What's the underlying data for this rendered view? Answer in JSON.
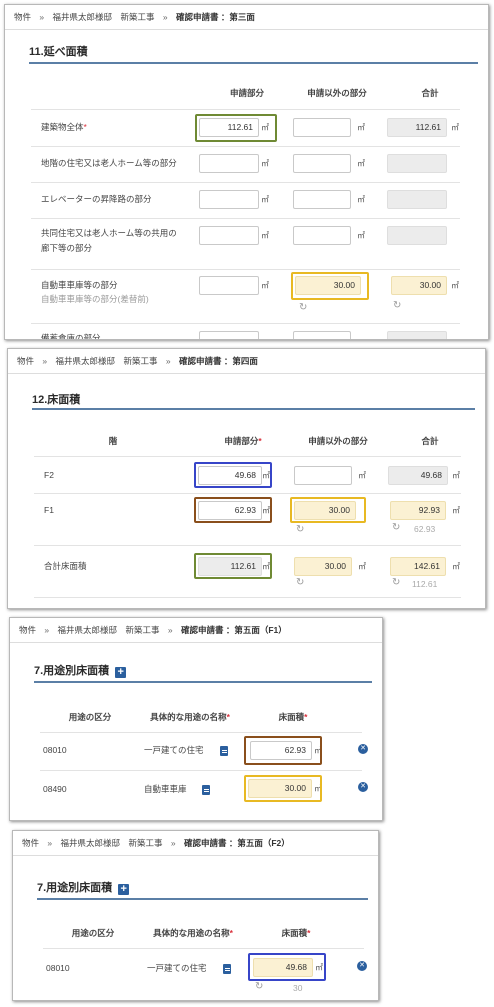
{
  "panel1": {
    "breadcrumb": {
      "item1": "物件",
      "sep": "»",
      "item2": "福井県太郎様邸　新築工事",
      "current": "確認申請書 ：第三面"
    },
    "title": "11.延べ面積",
    "headers": {
      "applied": "申請部分",
      "other": "申請以外の部分",
      "total": "合計"
    },
    "unit": "㎡",
    "rows": [
      {
        "label": "建築物全体",
        "required_mark": "*",
        "applied": "112.61",
        "other": "",
        "total": "112.61"
      },
      {
        "label": "地階の住宅又は老人ホーム等の部分",
        "applied": "",
        "other": "",
        "total": ""
      },
      {
        "label": "エレベーターの昇降路の部分",
        "applied": "",
        "other": "",
        "total": ""
      },
      {
        "label_line1": "共同住宅又は老人ホーム等の共用の",
        "label_line2": "廊下等の部分",
        "applied": "",
        "other": "",
        "total": ""
      },
      {
        "label": "自動車車庫等の部分",
        "sublabel": "自動車車庫等の部分(差替前)",
        "applied": "",
        "other": "30.00",
        "total": "30.00"
      },
      {
        "label": "備蓄倉庫の部分"
      }
    ]
  },
  "panel2": {
    "breadcrumb": {
      "item1": "物件",
      "sep": "»",
      "item2": "福井県太郎様邸　新築工事",
      "current": "確認申請書 ：第四面"
    },
    "title": "12.床面積",
    "headers": {
      "floor": "階",
      "applied": "申請部分",
      "required_mark": "*",
      "other": "申請以外の部分",
      "total": "合計"
    },
    "unit": "㎡",
    "rows": [
      {
        "label": "F2",
        "applied": "49.68",
        "other": "",
        "total": "49.68"
      },
      {
        "label": "F1",
        "applied": "62.93",
        "other": "30.00",
        "total": "92.93",
        "previous_total": "62.93"
      },
      {
        "label": "合計床面積",
        "applied": "112.61",
        "other": "30.00",
        "total": "142.61",
        "previous_total": "112.61"
      }
    ]
  },
  "panel3": {
    "breadcrumb": {
      "item1": "物件",
      "sep": "»",
      "item2": "福井県太郎様邸　新築工事",
      "current": "確認申請書 ：第五面（F1）"
    },
    "title": "7.用途別床面積",
    "headers": {
      "category": "用途の区分",
      "name": "具体的な用途の名称",
      "area": "床面積",
      "required_mark": "*"
    },
    "unit": "㎡",
    "rows": [
      {
        "code": "08010",
        "name": "一戸建ての住宅",
        "area": "62.93"
      },
      {
        "code": "08490",
        "name": "自動車車庫",
        "area": "30.00"
      }
    ]
  },
  "panel4": {
    "breadcrumb": {
      "item1": "物件",
      "sep": "»",
      "item2": "福井県太郎様邸　新築工事",
      "current": "確認申請書 ：第五面（F2）"
    },
    "title": "7.用途別床面積",
    "headers": {
      "category": "用途の区分",
      "name": "具体的な用途の名称",
      "area": "床面積",
      "required_mark": "*"
    },
    "unit": "㎡",
    "rows": [
      {
        "code": "08010",
        "name": "一戸建ての住宅",
        "area": "49.68",
        "previous": "30"
      }
    ]
  },
  "colors": {
    "accent_blue": "#2b5f9e",
    "highlight_fill": "#fbf1d3",
    "frame_olive": "#6f8a34",
    "frame_gold": "#e8b923",
    "frame_blue": "#3745c8",
    "frame_brown": "#8a4f1c",
    "required": "#d9303b"
  }
}
